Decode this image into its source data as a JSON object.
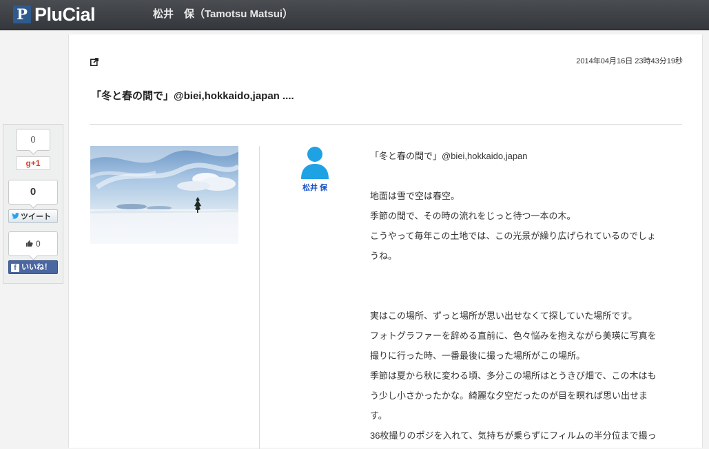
{
  "header": {
    "logo_letter": "P",
    "logo_text": "PluCial",
    "user_title": "松井　保（Tamotsu Matsui）"
  },
  "social": {
    "gplus_count": "0",
    "gplus_label": "g+1",
    "tweet_count": "0",
    "tweet_label": "ツイート",
    "like_count": "0",
    "like_label": "いいね！"
  },
  "post": {
    "timestamp": "2014年04月16日 23時43分19秒",
    "title": "「冬と春の間で」@biei,hokkaido,japan ....",
    "author": "松井 保",
    "body": [
      "「冬と春の間で」@biei,hokkaido,japan",
      "",
      "地面は雪で空は春空。",
      "季節の間で、その時の流れをじっと待つ一本の木。",
      "こうやって毎年この土地では、この光景が繰り広げられているのでしょ",
      "うね。",
      "",
      "",
      "実はこの場所、ずっと場所が思い出せなくて探していた場所です。",
      "フォトグラファーを辞める直前に、色々悩みを抱えながら美瑛に写真を",
      "撮りに行った時、一番最後に撮った場所がこの場所。",
      "季節は夏から秋に変わる頃、多分この場所はとうきび畑で、この木はも",
      "う少し小さかったかな。綺麗な夕空だったのが目を瞑れば思い出せま",
      "す。",
      "36枚撮りのポジを入れて、気持ちが乗らずにフィルムの半分位まで撮っ"
    ]
  },
  "colors": {
    "header_bg": "#3c3f44",
    "author_link": "#1a55c8",
    "facebook": "#4b67a1",
    "gplus": "#d54433",
    "twitter": "#2aa3ef"
  }
}
